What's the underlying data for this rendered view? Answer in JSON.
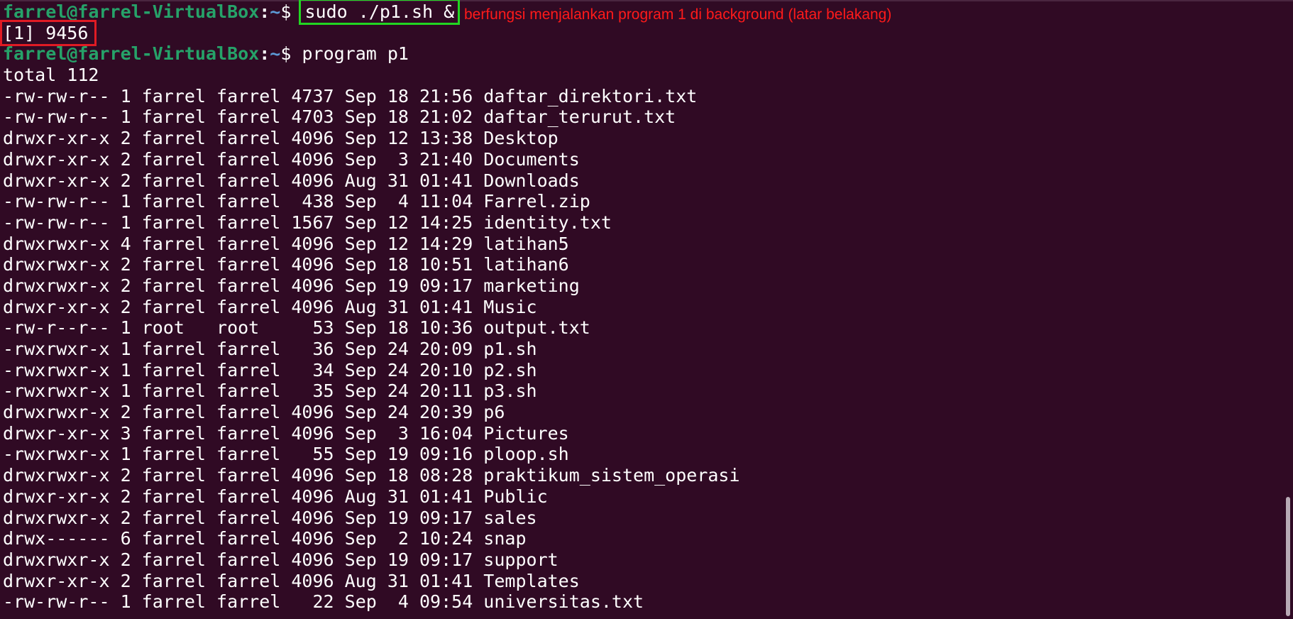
{
  "prompt": {
    "user_host": "farrel@farrel-VirtualBox",
    "colon": ":",
    "path": "~",
    "dollar": "$ "
  },
  "commands": {
    "first": "sudo ./p1.sh &",
    "second": "program p1"
  },
  "job_output": "[1] 9456",
  "annotation": "berfungsi menjalankan program 1 di background (latar belakang)",
  "listing": {
    "total": "total 112",
    "rows": [
      "-rw-rw-r-- 1 farrel farrel 4737 Sep 18 21:56 daftar_direktori.txt",
      "-rw-rw-r-- 1 farrel farrel 4703 Sep 18 21:02 daftar_terurut.txt",
      "drwxr-xr-x 2 farrel farrel 4096 Sep 12 13:38 Desktop",
      "drwxr-xr-x 2 farrel farrel 4096 Sep  3 21:40 Documents",
      "drwxr-xr-x 2 farrel farrel 4096 Aug 31 01:41 Downloads",
      "-rw-rw-r-- 1 farrel farrel  438 Sep  4 11:04 Farrel.zip",
      "-rw-rw-r-- 1 farrel farrel 1567 Sep 12 14:25 identity.txt",
      "drwxrwxr-x 4 farrel farrel 4096 Sep 12 14:29 latihan5",
      "drwxrwxr-x 2 farrel farrel 4096 Sep 18 10:51 latihan6",
      "drwxrwxr-x 2 farrel farrel 4096 Sep 19 09:17 marketing",
      "drwxr-xr-x 2 farrel farrel 4096 Aug 31 01:41 Music",
      "-rw-r--r-- 1 root   root     53 Sep 18 10:36 output.txt",
      "-rwxrwxr-x 1 farrel farrel   36 Sep 24 20:09 p1.sh",
      "-rwxrwxr-x 1 farrel farrel   34 Sep 24 20:10 p2.sh",
      "-rwxrwxr-x 1 farrel farrel   35 Sep 24 20:11 p3.sh",
      "drwxrwxr-x 2 farrel farrel 4096 Sep 24 20:39 p6",
      "drwxr-xr-x 3 farrel farrel 4096 Sep  3 16:04 Pictures",
      "-rwxrwxr-x 1 farrel farrel   55 Sep 19 09:16 ploop.sh",
      "drwxrwxr-x 2 farrel farrel 4096 Sep 18 08:28 praktikum_sistem_operasi",
      "drwxr-xr-x 2 farrel farrel 4096 Aug 31 01:41 Public",
      "drwxrwxr-x 2 farrel farrel 4096 Sep 19 09:17 sales",
      "drwx------ 6 farrel farrel 4096 Sep  2 10:24 snap",
      "drwxrwxr-x 2 farrel farrel 4096 Sep 19 09:17 support",
      "drwxr-xr-x 2 farrel farrel 4096 Aug 31 01:41 Templates",
      "-rw-rw-r-- 1 farrel farrel   22 Sep  4 09:54 universitas.txt"
    ]
  },
  "colors": {
    "background": "#300a24",
    "prompt_user": "#26a269",
    "prompt_path": "#5c9ad6",
    "highlight_green": "#22d622",
    "highlight_red": "#e01b24",
    "annotation_text": "#ff1a1a"
  }
}
